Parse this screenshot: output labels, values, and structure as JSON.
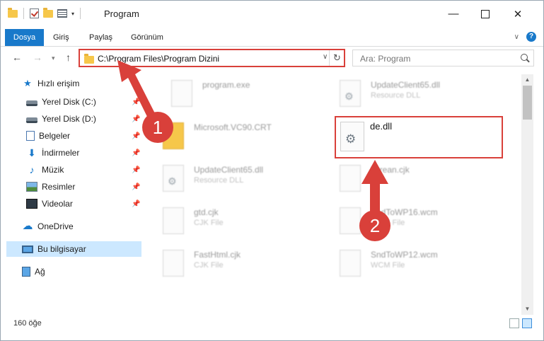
{
  "titlebar": {
    "title": "Program",
    "minimize": "—",
    "close": "✕"
  },
  "ribbon": {
    "tabs": [
      "Dosya",
      "Giriş",
      "Paylaş",
      "Görünüm"
    ],
    "help": "?"
  },
  "address": {
    "path": "C:\\Program Files\\Program Dizini",
    "search_placeholder": "Ara: Program"
  },
  "nav": {
    "items": [
      {
        "label": "Hızlı erişim",
        "icon": "star-icon"
      },
      {
        "label": "Yerel Disk (C:)",
        "icon": "drive-icon",
        "pinned": true
      },
      {
        "label": "Yerel Disk (D:)",
        "icon": "drive-icon",
        "pinned": true
      },
      {
        "label": "Belgeler",
        "icon": "documents-icon",
        "pinned": true
      },
      {
        "label": "İndirmeler",
        "icon": "download-icon",
        "pinned": true
      },
      {
        "label": "Müzik",
        "icon": "music-icon",
        "pinned": true
      },
      {
        "label": "Resimler",
        "icon": "pictures-icon",
        "pinned": true
      },
      {
        "label": "Videolar",
        "icon": "videos-icon",
        "pinned": true
      },
      {
        "label": "OneDrive",
        "icon": "cloud-icon"
      },
      {
        "label": "Bu bilgisayar",
        "icon": "computer-icon",
        "selected": true
      },
      {
        "label": "Ağ",
        "icon": "network-icon"
      }
    ]
  },
  "files": [
    {
      "name": "program.exe",
      "type": ""
    },
    {
      "name": "UpdateClient65.dll",
      "type": "Resource DLL"
    },
    {
      "name": "Microsoft.VC90.CRT",
      "type": ""
    },
    {
      "name": "UpdateClient65.dll",
      "type": "Resource DLL"
    },
    {
      "name": "korean.cjk",
      "type": ""
    },
    {
      "name": "gtd.cjk",
      "type": "CJK File"
    },
    {
      "name": "SndToWP16.wcm",
      "type": "WCM File"
    },
    {
      "name": "FastHtml.cjk",
      "type": "CJK File"
    },
    {
      "name": "SndToWP12.wcm",
      "type": "WCM File"
    }
  ],
  "highlighted_file": {
    "name": "de.dll"
  },
  "annotations": {
    "step1": "1",
    "step2": "2",
    "color": "#d9403a"
  },
  "status": {
    "count": "160 öğe"
  },
  "colors": {
    "accent": "#1979ca",
    "selection": "#cce8ff",
    "annotation": "#d9403a"
  }
}
